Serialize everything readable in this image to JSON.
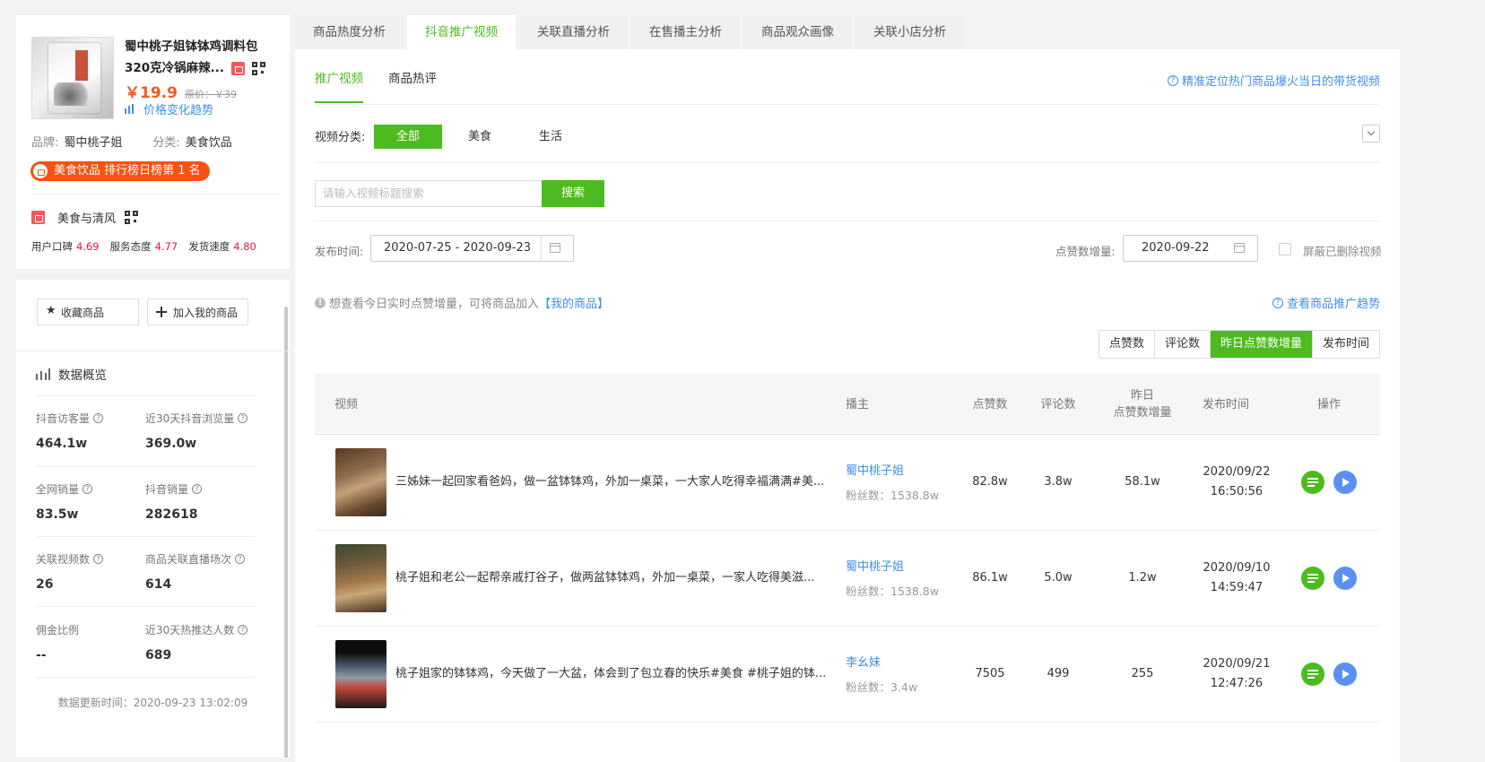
{
  "product": {
    "title_line1": "蜀中桃子姐钵钵鸡调料包",
    "title_line2": "320克冷锅麻辣...",
    "price": "￥19.9",
    "original_price": "原价：￥39",
    "price_trend_link": "价格变化趋势",
    "brand_label": "品牌:",
    "brand": "蜀中桃子姐",
    "category_label": "分类:",
    "category": "美食饮品",
    "rank_badge": "美食饮品 排行榜日榜第 1 名"
  },
  "store": {
    "name": "美食与清风",
    "ratings": [
      {
        "label": "用户口碑",
        "value": "4.69"
      },
      {
        "label": "服务态度",
        "value": "4.77"
      },
      {
        "label": "发货速度",
        "value": "4.80"
      }
    ]
  },
  "actions": {
    "favorite": "收藏商品",
    "add_mine": "加入我的商品"
  },
  "overview": {
    "title": "数据概览",
    "stats": [
      {
        "label": "抖音访客量",
        "value": "464.1w"
      },
      {
        "label": "近30天抖音浏览量",
        "value": "369.0w"
      },
      {
        "label": "全网销量",
        "value": "83.5w"
      },
      {
        "label": "抖音销量",
        "value": "282618"
      },
      {
        "label": "关联视频数",
        "value": "26"
      },
      {
        "label": "商品关联直播场次",
        "value": "614"
      },
      {
        "label": "佣金比例",
        "value": "--"
      },
      {
        "label": "近30天热推达人数",
        "value": "689"
      }
    ],
    "updated": "数据更新时间：2020-09-23 13:02:09"
  },
  "tabs": [
    "商品热度分析",
    "抖音推广视频",
    "关联直播分析",
    "在售播主分析",
    "商品观众画像",
    "关联小店分析"
  ],
  "subtabs": [
    "推广视频",
    "商品热评"
  ],
  "help_top": "精准定位热门商品爆火当日的带货视频",
  "filter": {
    "category_label": "视频分类:",
    "categories": [
      "全部",
      "美食",
      "生活"
    ],
    "search_placeholder": "请输入视频标题搜索",
    "search_button": "搜索",
    "publish_label": "发布时间:",
    "publish_range": "2020-07-25 - 2020-09-23",
    "likes_inc_label": "点赞数增量:",
    "likes_inc_date": "2020-09-22",
    "hide_deleted": "屏蔽已删除视频"
  },
  "hint": {
    "text": "想查看今日实时点赞增量，可将商品加入",
    "link": "【我的商品】",
    "trend": "查看商品推广趋势"
  },
  "sort": [
    "点赞数",
    "评论数",
    "昨日点赞数增量",
    "发布时间"
  ],
  "table": {
    "headers": {
      "video": "视频",
      "host": "播主",
      "likes": "点赞数",
      "comments": "评论数",
      "inc_line1": "昨日",
      "inc_line2": "点赞数增量",
      "time": "发布时间",
      "ops": "操作"
    },
    "rows": [
      {
        "title": "三姊妹一起回家看爸妈，做一盆钵钵鸡，外加一桌菜，一大家人吃得幸福满满#美...",
        "host": "蜀中桃子姐",
        "fans": "粉丝数：1538.8w",
        "likes": "82.8w",
        "comments": "3.8w",
        "inc": "58.1w",
        "date": "2020/09/22",
        "time": "16:50:56"
      },
      {
        "title": "桃子姐和老公一起帮亲戚打谷子，做两盆钵钵鸡，外加一桌菜，一家人吃得美滋...",
        "host": "蜀中桃子姐",
        "fans": "粉丝数：1538.8w",
        "likes": "86.1w",
        "comments": "5.0w",
        "inc": "1.2w",
        "date": "2020/09/10",
        "time": "14:59:47"
      },
      {
        "title": "桃子姐家的钵钵鸡，今天做了一大盆，体会到了包立春的快乐#美食 #桃子姐的钵...",
        "host": "李幺妹",
        "fans": "粉丝数：3.4w",
        "likes": "7505",
        "comments": "499",
        "inc": "255",
        "date": "2020/09/21",
        "time": "12:47:26"
      }
    ]
  },
  "colors": {
    "accent": "#4dbb1f",
    "link": "#3f8fe8",
    "price": "#f15a24",
    "rank": "#fa5112",
    "rating": "#e6163e"
  }
}
